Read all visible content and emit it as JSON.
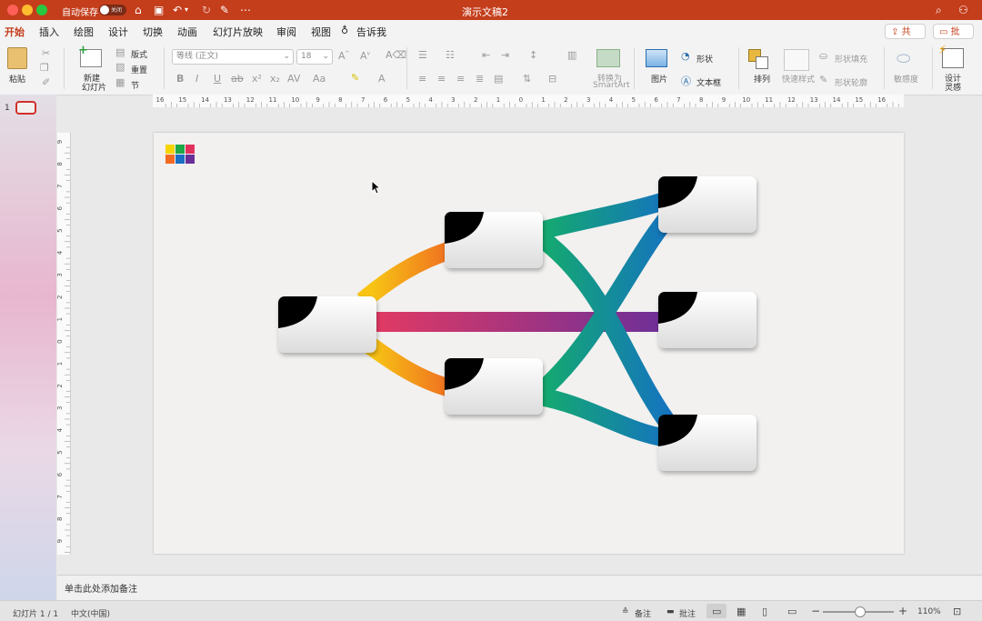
{
  "titlebar": {
    "autosave_label": "自动保存",
    "autosave_state": "关闭",
    "doc_title": "演示文稿2"
  },
  "tabs": [
    "开始",
    "插入",
    "绘图",
    "设计",
    "切换",
    "动画",
    "幻灯片放映",
    "审阅",
    "视图"
  ],
  "tell_me": "告诉我",
  "share_label": "共享",
  "comment_label": "批注",
  "ribbon": {
    "paste": "粘贴",
    "new_slide_line1": "新建",
    "new_slide_line2": "幻灯片",
    "layout": "版式",
    "reset": "重置",
    "section": "节",
    "font_name": "等线 (正文)",
    "font_size": "18",
    "smartart_line1": "转换为",
    "smartart_line2": "SmartArt",
    "picture": "图片",
    "shapes": "形状",
    "textbox": "文本框",
    "arrange": "排列",
    "quick_styles": "快速样式",
    "shape_fill": "形状填充",
    "shape_outline": "形状轮廓",
    "sensitivity": "敏感度",
    "designer_line1": "设计",
    "designer_line2": "灵感"
  },
  "ruler_labels": [
    "16",
    "15",
    "14",
    "13",
    "12",
    "11",
    "10",
    "9",
    "8",
    "7",
    "6",
    "5",
    "4",
    "3",
    "2",
    "1",
    "0",
    "1",
    "2",
    "3",
    "4",
    "5",
    "6",
    "7",
    "8",
    "9",
    "10",
    "11",
    "12",
    "13",
    "14",
    "15",
    "16"
  ],
  "vruler_labels": [
    "9",
    "8",
    "7",
    "6",
    "5",
    "4",
    "3",
    "2",
    "1",
    "0",
    "1",
    "2",
    "3",
    "4",
    "5",
    "6",
    "7",
    "8",
    "9"
  ],
  "thumbnail": {
    "number": "1"
  },
  "notes_placeholder": "单击此处添加备注",
  "status": {
    "slide_info": "幻灯片 1 / 1",
    "language": "中文(中国)",
    "notes_btn": "备注",
    "comments_btn": "批注",
    "zoom": "110%"
  },
  "colors": {
    "accent": "#c43e1c",
    "path_orange": "#f0a21a",
    "path_pink": "#d63a6e",
    "path_purple": "#6a2f97",
    "path_teal": "#12a777",
    "path_blue": "#1273c4"
  }
}
